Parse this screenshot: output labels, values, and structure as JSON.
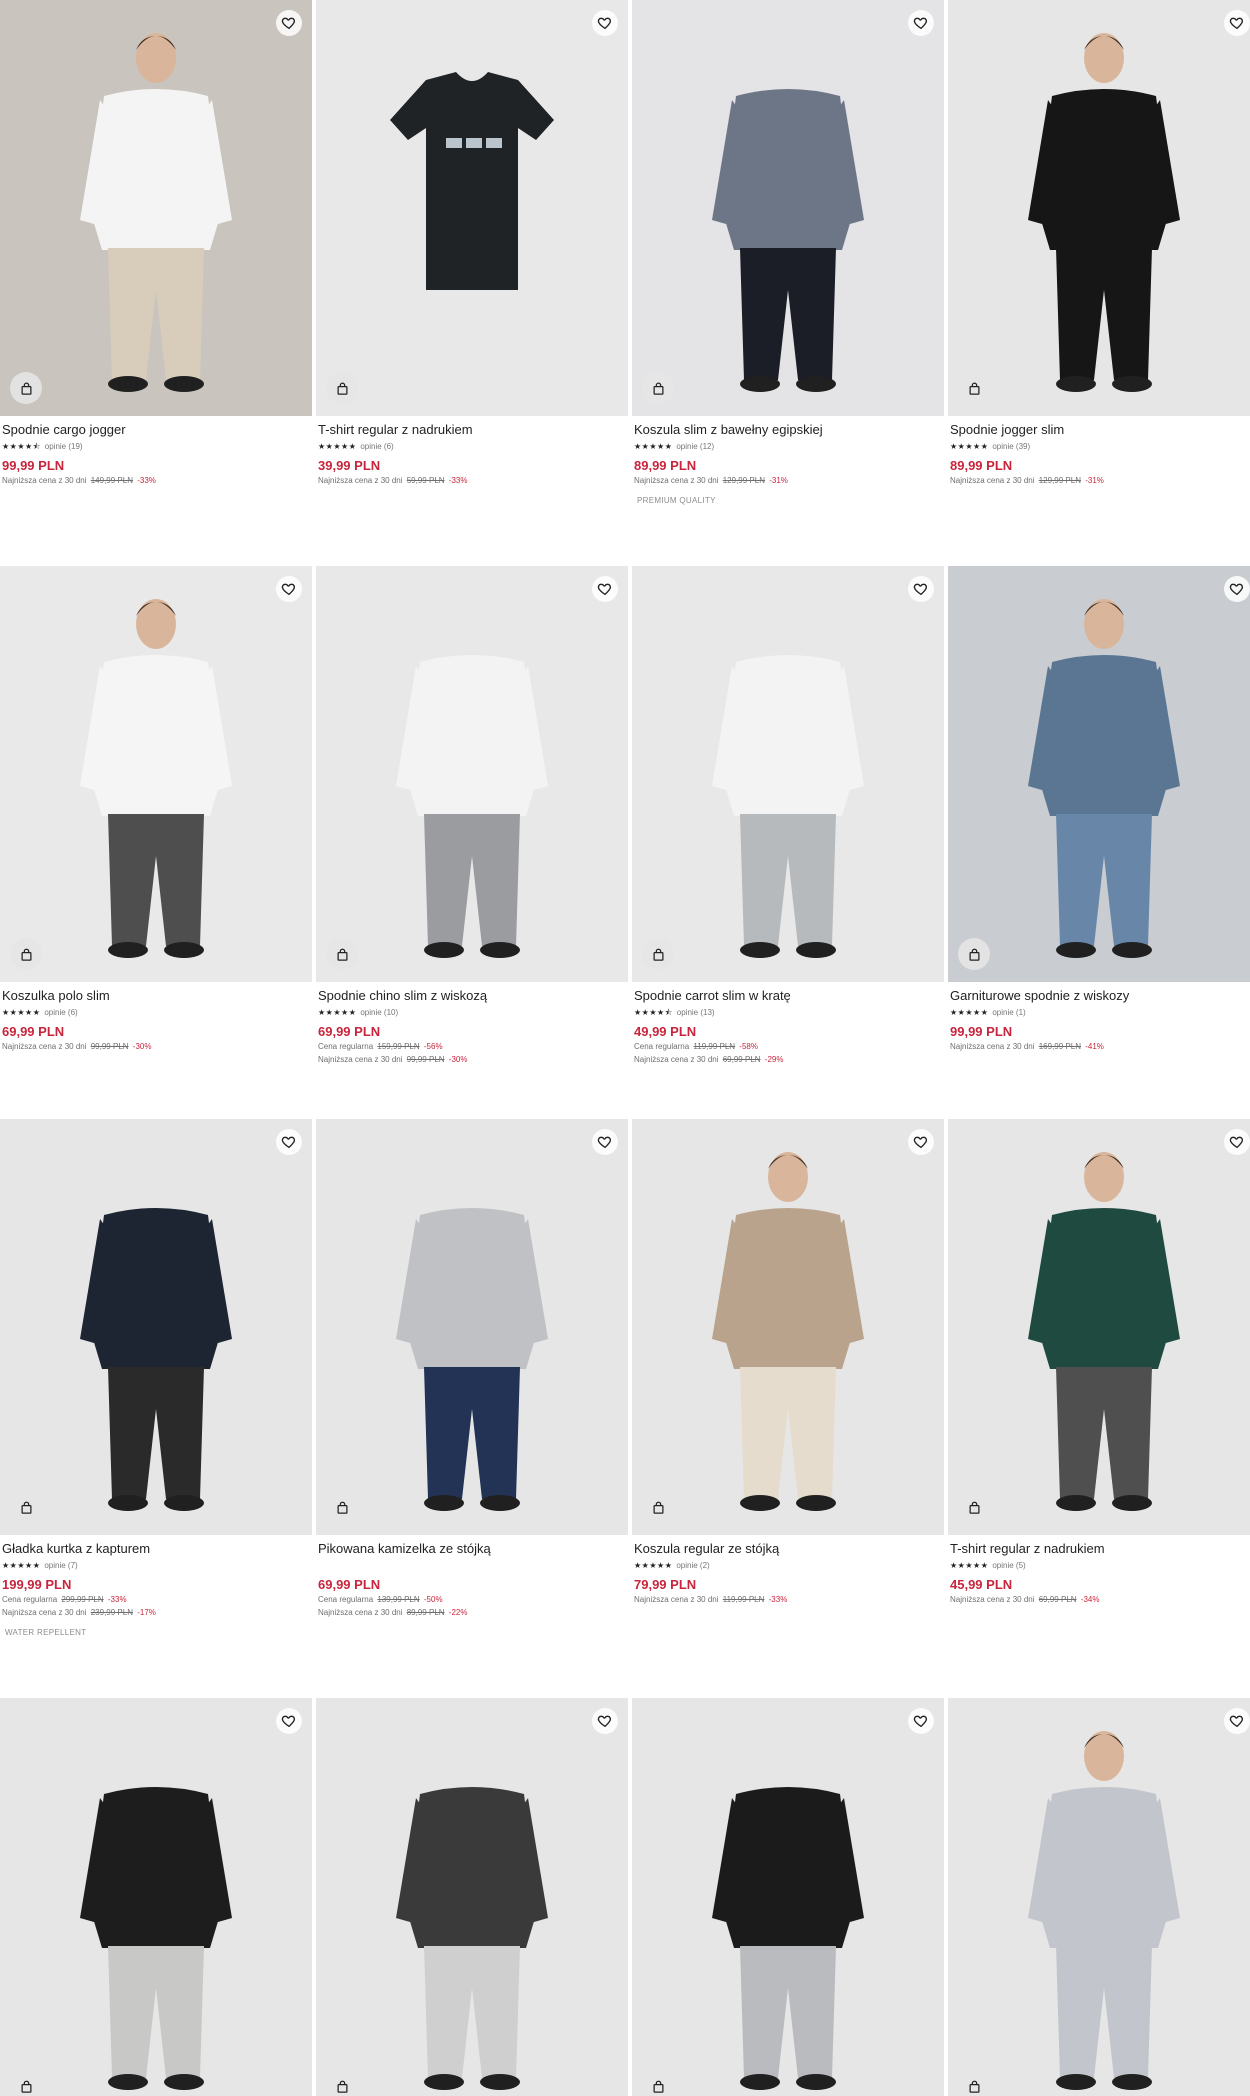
{
  "colors": {
    "price": "#c8253c",
    "text": "#222222",
    "muted": "#777777"
  },
  "icons": {
    "favorite": "heart-icon",
    "cart": "shopping-bag-icon",
    "rating": "star-icon"
  },
  "products": [
    {
      "name": "Spodnie cargo jogger",
      "stars": "★★★★⯪",
      "reviews": "opinie (19)",
      "price": "99,99 PLN",
      "regular": null,
      "lowest": {
        "label": "Najniższa cena z 30 dni",
        "old": "149,99 PLN",
        "disc": "-33%"
      },
      "badge": null,
      "bg": "#c9c4bd"
    },
    {
      "name": "T-shirt regular z nadrukiem",
      "stars": "★★★★★",
      "reviews": "opinie (6)",
      "price": "39,99 PLN",
      "regular": null,
      "lowest": {
        "label": "Najniższa cena z 30 dni",
        "old": "59,99 PLN",
        "disc": "-33%"
      },
      "badge": null,
      "bg": "#e8e8e8"
    },
    {
      "name": "Koszula slim z bawełny egipskiej",
      "stars": "★★★★★",
      "reviews": "opinie (12)",
      "price": "89,99 PLN",
      "regular": null,
      "lowest": {
        "label": "Najniższa cena z 30 dni",
        "old": "129,99 PLN",
        "disc": "-31%"
      },
      "badge": "PREMIUM QUALITY",
      "bg": "#e4e4e6"
    },
    {
      "name": "Spodnie jogger slim",
      "stars": "★★★★★",
      "reviews": "opinie (39)",
      "price": "89,99 PLN",
      "regular": null,
      "lowest": {
        "label": "Najniższa cena z 30 dni",
        "old": "129,99 PLN",
        "disc": "-31%"
      },
      "badge": null,
      "bg": "#e6e6e6"
    },
    {
      "name": "Koszulka polo slim",
      "stars": "★★★★★",
      "reviews": "opinie (6)",
      "price": "69,99 PLN",
      "regular": null,
      "lowest": {
        "label": "Najniższa cena z 30 dni",
        "old": "99,99 PLN",
        "disc": "-30%"
      },
      "badge": null,
      "bg": "#e9e9e9"
    },
    {
      "name": "Spodnie chino slim z wiskozą",
      "stars": "★★★★★",
      "reviews": "opinie (10)",
      "price": "69,99 PLN",
      "regular": {
        "label": "Cena regularna",
        "old": "159,99 PLN",
        "disc": "-56%"
      },
      "lowest": {
        "label": "Najniższa cena z 30 dni",
        "old": "99,99 PLN",
        "disc": "-30%"
      },
      "badge": null,
      "bg": "#e8e8e8"
    },
    {
      "name": "Spodnie carrot slim w kratę",
      "stars": "★★★★⯪",
      "reviews": "opinie (13)",
      "price": "49,99 PLN",
      "regular": {
        "label": "Cena regularna",
        "old": "119,99 PLN",
        "disc": "-58%"
      },
      "lowest": {
        "label": "Najniższa cena z 30 dni",
        "old": "69,99 PLN",
        "disc": "-29%"
      },
      "badge": null,
      "bg": "#e8e8e8"
    },
    {
      "name": "Garniturowe spodnie z wiskozy",
      "stars": "★★★★★",
      "reviews": "opinie (1)",
      "price": "99,99 PLN",
      "regular": null,
      "lowest": {
        "label": "Najniższa cena z 30 dni",
        "old": "169,99 PLN",
        "disc": "-41%"
      },
      "badge": null,
      "bg": "#c9ccd0"
    },
    {
      "name": "Gładka kurtka z kapturem",
      "stars": "★★★★★",
      "reviews": "opinie (7)",
      "price": "199,99 PLN",
      "regular": {
        "label": "Cena regularna",
        "old": "299,99 PLN",
        "disc": "-33%"
      },
      "lowest": {
        "label": "Najniższa cena z 30 dni",
        "old": "239,99 PLN",
        "disc": "-17%"
      },
      "badge": "WATER REPELLENT",
      "bg": "#e6e6e6"
    },
    {
      "name": "Pikowana kamizelka ze stójką",
      "stars": "",
      "reviews": "",
      "price": "69,99 PLN",
      "regular": {
        "label": "Cena regularna",
        "old": "139,99 PLN",
        "disc": "-50%"
      },
      "lowest": {
        "label": "Najniższa cena z 30 dni",
        "old": "89,99 PLN",
        "disc": "-22%"
      },
      "badge": null,
      "bg": "#e6e6e6"
    },
    {
      "name": "Koszula regular ze stójką",
      "stars": "★★★★★",
      "reviews": "opinie (2)",
      "price": "79,99 PLN",
      "regular": null,
      "lowest": {
        "label": "Najniższa cena z 30 dni",
        "old": "119,99 PLN",
        "disc": "-33%"
      },
      "badge": null,
      "bg": "#e6e6e6"
    },
    {
      "name": "T-shirt regular z nadrukiem",
      "stars": "★★★★★",
      "reviews": "opinie (5)",
      "price": "45,99 PLN",
      "regular": null,
      "lowest": {
        "label": "Najniższa cena z 30 dni",
        "old": "69,99 PLN",
        "disc": "-34%"
      },
      "badge": null,
      "bg": "#e6e6e6"
    },
    {
      "name": "",
      "stars": "",
      "reviews": "",
      "price": "",
      "regular": null,
      "lowest": null,
      "badge": null,
      "bg": "#e6e6e6"
    },
    {
      "name": "",
      "stars": "",
      "reviews": "",
      "price": "",
      "regular": null,
      "lowest": null,
      "badge": null,
      "bg": "#e6e6e6"
    },
    {
      "name": "",
      "stars": "",
      "reviews": "",
      "price": "",
      "regular": null,
      "lowest": null,
      "badge": null,
      "bg": "#e6e6e6"
    },
    {
      "name": "",
      "stars": "",
      "reviews": "",
      "price": "",
      "regular": null,
      "lowest": null,
      "badge": null,
      "bg": "#e6e6e6"
    }
  ]
}
